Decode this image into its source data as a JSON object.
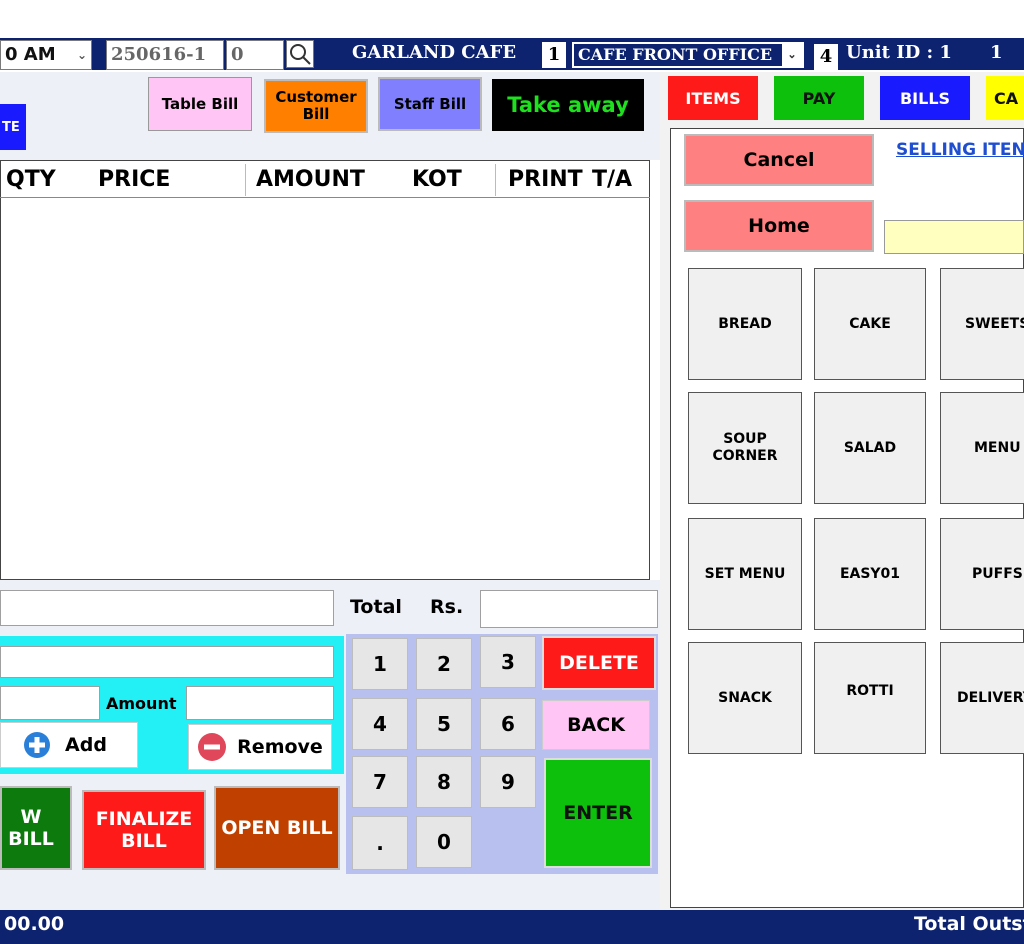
{
  "topbar": {
    "time": "0 AM",
    "bill_no": "250616-1",
    "bill_sub": "0",
    "cafe_name": "GARLAND CAFE",
    "num1": "1",
    "location": "CAFE FRONT OFFICE",
    "num2": "4",
    "unit_label": "Unit ID : 1",
    "unit_value": "1"
  },
  "bill_types": {
    "partial": "TE",
    "table": "Table Bill",
    "customer": "Customer Bill",
    "staff": "Staff Bill",
    "takeaway": "Take away"
  },
  "table_headers": [
    "QTY",
    "PRICE",
    "AMOUNT",
    "KOT",
    "PRINT",
    "T/A"
  ],
  "total": {
    "label": "Total",
    "currency": "Rs."
  },
  "entry": {
    "amount_label": "Amount",
    "add": "Add",
    "remove": "Remove"
  },
  "actions": {
    "new_bill": "W BILL",
    "finalize": "FINALIZE BILL",
    "open_bill": "OPEN BILL"
  },
  "keypad": {
    "keys": [
      "1",
      "2",
      "3",
      "4",
      "5",
      "6",
      "7",
      "8",
      "9",
      ".",
      "0"
    ],
    "delete": "DELETE",
    "back": "BACK",
    "enter": "ENTER"
  },
  "right_tabs": [
    "ITEMS",
    "PAY",
    "BILLS",
    "CA"
  ],
  "nav": {
    "cancel": "Cancel",
    "home": "Home",
    "selling_link": "SELLING ITEN"
  },
  "categories": [
    "BREAD",
    "CAKE",
    "SWEETS",
    "SOUP CORNER",
    "SALAD",
    "MENU",
    "SET MENU",
    "EASY01",
    "PUFFS",
    "SNACK",
    "ROTTI",
    "DELIVERY"
  ],
  "statusbar": {
    "left": "00.00",
    "right": "Total Outst"
  },
  "colors": {
    "navy": "#0e2370",
    "table_bill": "#ffc6f5",
    "customer_bill": "#ff8000",
    "staff_bill": "#8080ff",
    "takeaway_bg": "#000000",
    "takeaway_text": "#1ee01e",
    "cyan_panel": "#22f0f4",
    "delete_red": "#ff1a1a",
    "enter_green": "#0cc00c",
    "cancel_home": "#ff8080"
  }
}
